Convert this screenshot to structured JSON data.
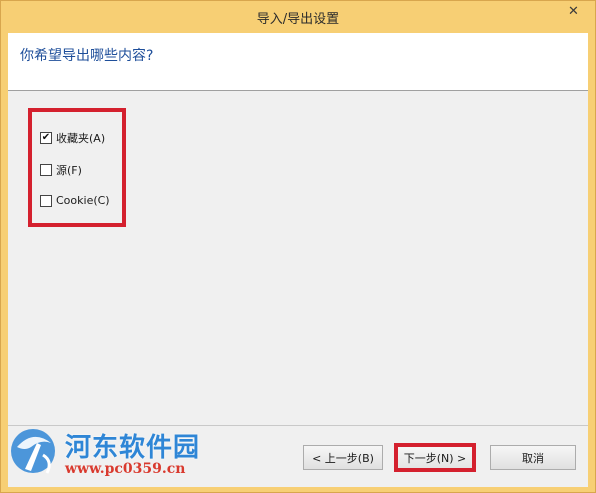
{
  "window": {
    "title": "导入/导出设置",
    "close_glyph": "✕"
  },
  "header": {
    "question": "你希望导出哪些内容?"
  },
  "options": [
    {
      "label": "收藏夹(A)",
      "checked": true
    },
    {
      "label": "源(F)",
      "checked": false
    },
    {
      "label": "Cookie(C)",
      "checked": false
    }
  ],
  "buttons": {
    "back": "< 上一步(B)",
    "next": "下一步(N) >",
    "cancel": "取消"
  },
  "watermark": {
    "name": "河东软件园",
    "url": "www.pc0359.cn"
  },
  "colors": {
    "frame": "#f7cf74",
    "highlight_box": "#d4202e",
    "question_text": "#1e4e9a",
    "watermark_blue": "#2f86d6",
    "watermark_red": "#d93a2e"
  }
}
